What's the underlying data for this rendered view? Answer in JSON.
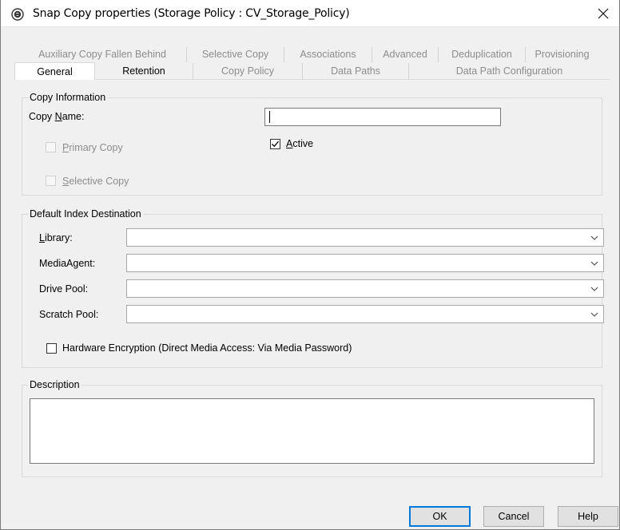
{
  "window": {
    "title": "Snap Copy properties (Storage Policy : CV_Storage_Policy)"
  },
  "tabs": {
    "row1": [
      "Auxiliary Copy Fallen Behind",
      "Selective Copy",
      "Associations",
      "Advanced",
      "Deduplication",
      "Provisioning"
    ],
    "row2": [
      "General",
      "Retention",
      "Copy Policy",
      "Data Paths",
      "Data Path Configuration"
    ],
    "active": "General"
  },
  "copy_information": {
    "group_label": "Copy Information",
    "copy_name_label": "Copy Name:",
    "copy_name_value": "",
    "primary_copy_label": "Primary Copy",
    "primary_copy_checked": false,
    "selective_copy_label": "Selective Copy",
    "selective_copy_checked": false,
    "active_label": "Active",
    "active_checked": true
  },
  "default_index_destination": {
    "group_label": "Default Index Destination",
    "library_label": "Library:",
    "library_value": "",
    "media_agent_label": "MediaAgent:",
    "media_agent_value": "",
    "drive_pool_label": "Drive Pool:",
    "drive_pool_value": "",
    "scratch_pool_label": "Scratch Pool:",
    "scratch_pool_value": "",
    "hardware_encryption_label": "Hardware Encryption (Direct Media Access: Via Media Password)",
    "hardware_encryption_checked": false
  },
  "description": {
    "group_label": "Description",
    "value": ""
  },
  "buttons": {
    "ok": "OK",
    "cancel": "Cancel",
    "help": "Help"
  },
  "icons": {
    "app": "storage-policy-icon",
    "close": "close-icon",
    "dropdown": "chevron-down-icon",
    "check": "checkmark-icon"
  },
  "colors": {
    "dialog_bg": "#f0f0f0",
    "disabled_text": "#8c8c8c",
    "default_button_border": "#0078d7"
  }
}
